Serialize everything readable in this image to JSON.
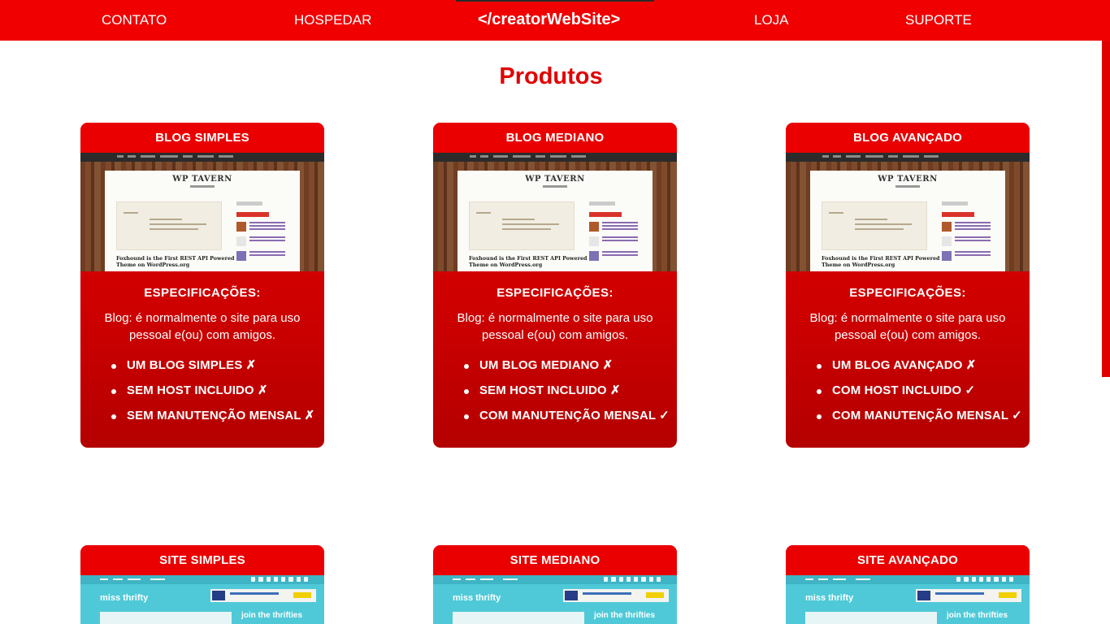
{
  "nav": {
    "items": [
      "CONTATO",
      "HOSPEDAR",
      "LOJA",
      "SUPORTE"
    ],
    "brand": "</creatorWebSite>",
    "color": "#f00000"
  },
  "main": {
    "title": "Produtos"
  },
  "blog_cards": [
    {
      "title": "BLOG SIMPLES",
      "spec_title": "ESPECIFICAÇÕES:",
      "description": "Blog: é normalmente o site para uso pessoal e(ou) com amigos.",
      "features": [
        "UM BLOG SIMPLES ✗",
        "SEM HOST INCLUIDO ✗",
        "SEM MANUTENÇÃO MENSAL ✗"
      ],
      "preview": {
        "logo": "WP TAVERN",
        "headline": "Foxhound is the First REST API Powered Theme on WordPress.org"
      }
    },
    {
      "title": "BLOG MEDIANO",
      "spec_title": "ESPECIFICAÇÕES:",
      "description": "Blog: é normalmente o site para uso pessoal e(ou) com amigos.",
      "features": [
        "UM BLOG MEDIANO ✗",
        "SEM HOST INCLUIDO ✗",
        "COM MANUTENÇÃO MENSAL ✓"
      ],
      "preview": {
        "logo": "WP TAVERN",
        "headline": "Foxhound is the First REST API Powered Theme on WordPress.org"
      }
    },
    {
      "title": "BLOG AVANÇADO",
      "spec_title": "ESPECIFICAÇÕES:",
      "description": "Blog: é normalmente o site para uso pessoal e(ou) com amigos.",
      "features": [
        "UM BLOG AVANÇADO ✗",
        "COM HOST INCLUIDO ✓",
        "COM MANUTENÇÃO MENSAL ✓"
      ],
      "preview": {
        "logo": "WP TAVERN",
        "headline": "Foxhound is the First REST API Powered Theme on WordPress.org"
      }
    }
  ],
  "site_cards": [
    {
      "title": "SITE SIMPLES",
      "preview": {
        "name": "miss thrifty",
        "join": "join the thrifties"
      }
    },
    {
      "title": "SITE MEDIANO",
      "preview": {
        "name": "miss thrifty",
        "join": "join the thrifties"
      }
    },
    {
      "title": "SITE AVANÇADO",
      "preview": {
        "name": "miss thrifty",
        "join": "join the thrifties"
      }
    }
  ]
}
